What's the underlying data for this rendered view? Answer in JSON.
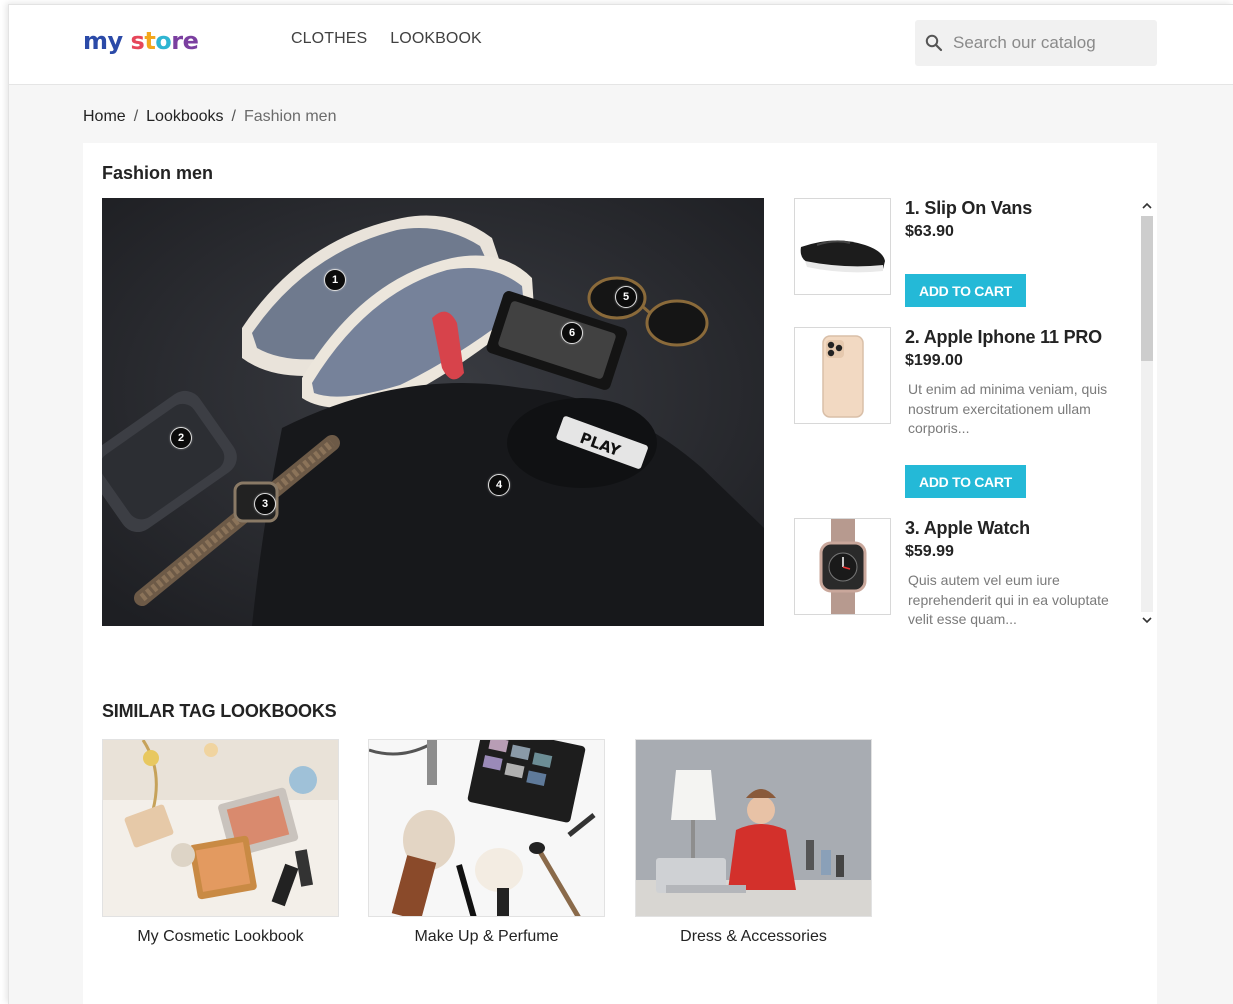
{
  "header": {
    "logo": {
      "part1": "my",
      "part2": "s",
      "part3": "t",
      "part4": "o",
      "part5": "re"
    },
    "nav": [
      {
        "label": "CLOTHES"
      },
      {
        "label": "LOOKBOOK"
      }
    ],
    "search": {
      "placeholder": "Search our catalog",
      "icon": "search-icon"
    }
  },
  "breadcrumb": {
    "items": [
      "Home",
      "Lookbooks",
      "Fashion men"
    ],
    "separator": "/"
  },
  "lookbook": {
    "title": "Fashion men",
    "pins": [
      "1",
      "2",
      "3",
      "4",
      "5",
      "6"
    ]
  },
  "products": [
    {
      "name": "1. Slip On Vans",
      "price": "$63.90",
      "description": "",
      "button": "ADD TO CART"
    },
    {
      "name": "2. Apple Iphone 11 PRO",
      "price": "$199.00",
      "description": "Ut enim ad minima veniam, quis nostrum exercitationem ullam corporis...",
      "button": "ADD TO CART"
    },
    {
      "name": "3. Apple Watch",
      "price": "$59.99",
      "description": "Quis autem vel eum iure reprehenderit qui in ea voluptate velit esse quam..."
    }
  ],
  "similar": {
    "title": "SIMILAR TAG LOOKBOOKS",
    "items": [
      {
        "label": "My Cosmetic Lookbook"
      },
      {
        "label": "Make Up & Perfume"
      },
      {
        "label": "Dress & Accessories"
      }
    ]
  },
  "colors": {
    "accent": "#24b9d7",
    "text": "#232323",
    "muted": "#7a7a7a",
    "background": "#f6f6f6"
  }
}
